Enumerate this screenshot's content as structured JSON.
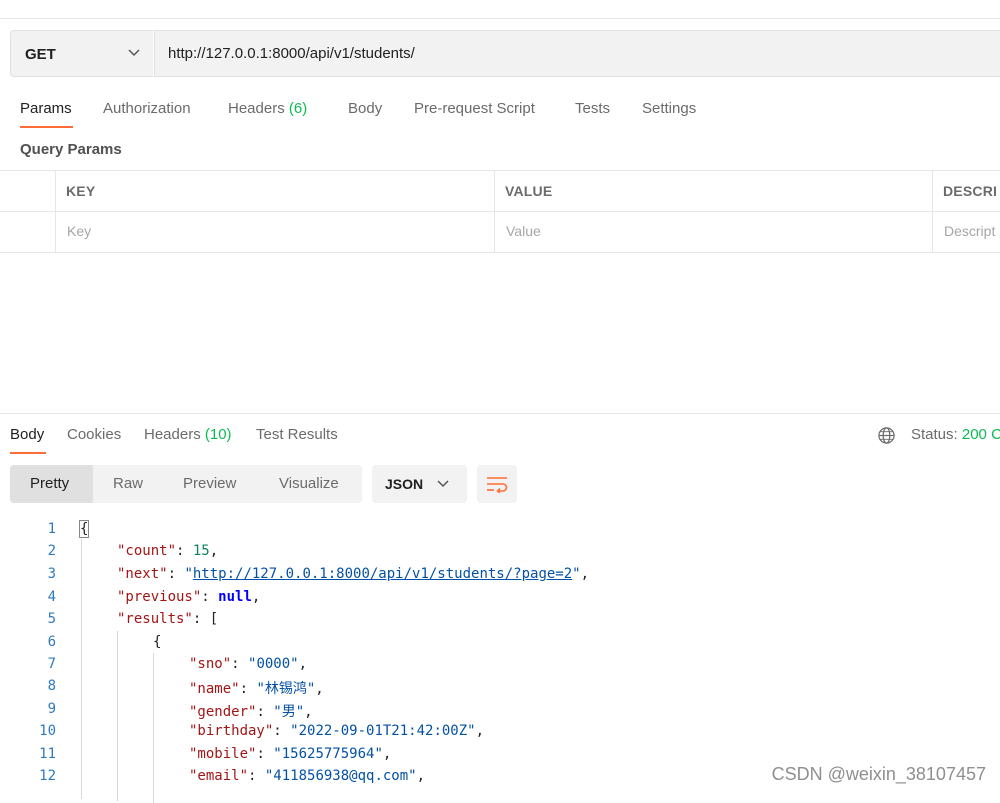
{
  "request": {
    "method": "GET",
    "url": "http://127.0.0.1:8000/api/v1/students/"
  },
  "request_tabs": [
    {
      "label": "Params"
    },
    {
      "label": "Authorization"
    },
    {
      "label": "Headers",
      "count": "(6)"
    },
    {
      "label": "Body"
    },
    {
      "label": "Pre-request Script"
    },
    {
      "label": "Tests"
    },
    {
      "label": "Settings"
    }
  ],
  "query_params": {
    "title": "Query Params",
    "columns": [
      "KEY",
      "VALUE",
      "DESCRI"
    ],
    "placeholders": [
      "Key",
      "Value",
      "Descript"
    ]
  },
  "response": {
    "tabs": [
      {
        "label": "Body"
      },
      {
        "label": "Cookies"
      },
      {
        "label": "Headers",
        "count": "(10)"
      },
      {
        "label": "Test Results"
      }
    ],
    "status_label": "Status:",
    "status_value": "200 C",
    "view_modes": [
      "Pretty",
      "Raw",
      "Preview",
      "Visualize"
    ],
    "format": "JSON"
  },
  "code": {
    "line_numbers": [
      "1",
      "2",
      "3",
      "4",
      "5",
      "6",
      "7",
      "8",
      "9",
      "10",
      "11",
      "12"
    ],
    "open_brace": "{",
    "count_key": "\"count\"",
    "count_value": "15",
    "next_key": "\"next\"",
    "next_value": "http://127.0.0.1:8000/api/v1/students/?page=2",
    "previous_key": "\"previous\"",
    "previous_value": "null",
    "results_key": "\"results\"",
    "results_open": "[",
    "item_open": "{",
    "sno_key": "\"sno\"",
    "sno_value": "\"0000\"",
    "name_key": "\"name\"",
    "name_value": "\"林锡鸿\"",
    "gender_key": "\"gender\"",
    "gender_value": "\"男\"",
    "birthday_key": "\"birthday\"",
    "birthday_value": "\"2022-09-01T21:42:00Z\"",
    "mobile_key": "\"mobile\"",
    "mobile_value": "\"15625775964\"",
    "email_key": "\"email\"",
    "email_value": "\"411856938@qq.com\""
  },
  "watermark": "CSDN @weixin_38107457",
  "colors": {
    "accent": "#ff6c37",
    "success": "#0cbb52",
    "line_number": "#2f7ac0"
  }
}
